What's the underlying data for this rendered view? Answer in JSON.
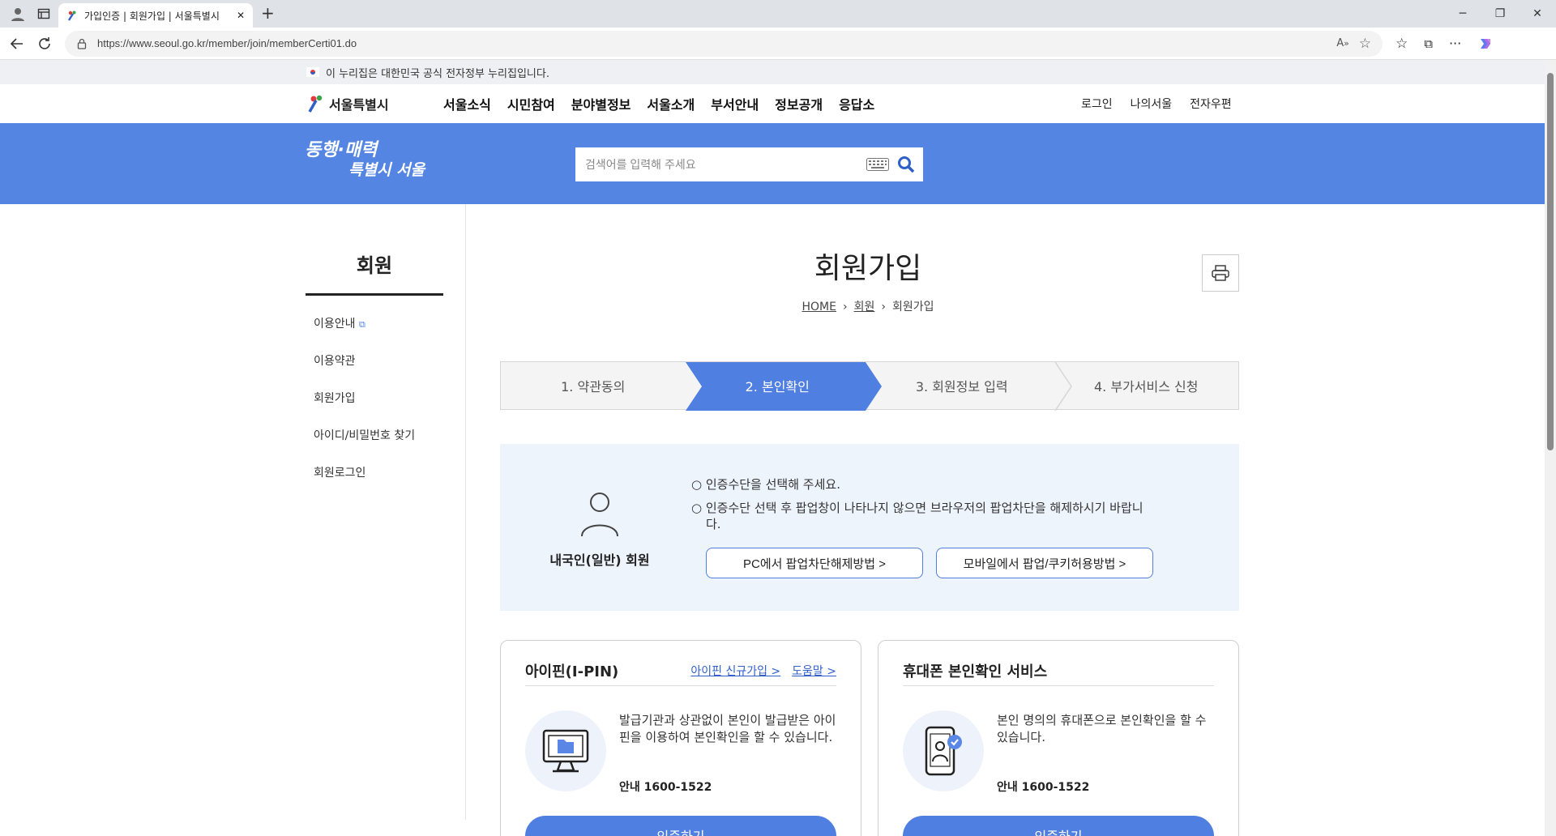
{
  "browser": {
    "tab_title": "가입인증 | 회원가입 | 서울특별시",
    "url": "https://www.seoul.go.kr/member/join/memberCerti01.do"
  },
  "gov_notice": "이 누리집은 대한민국 공식 전자정부 누리집입니다.",
  "brand": {
    "name": "서울특별시"
  },
  "main_menu": [
    "서울소식",
    "시민참여",
    "분야별정보",
    "서울소개",
    "부서안내",
    "정보공개",
    "응답소"
  ],
  "util_menu": [
    "로그인",
    "나의서울",
    "전자우편"
  ],
  "banner": {
    "slogan_line1": "동행·매력",
    "slogan_line2": "특별시 서울",
    "search_placeholder": "검색어를 입력해 주세요"
  },
  "sidebar": {
    "title": "회원",
    "items": [
      "이용안내",
      "이용약관",
      "회원가입",
      "아이디/비밀번호 찾기",
      "회원로그인"
    ]
  },
  "page": {
    "title": "회원가입",
    "breadcrumb": [
      "HOME",
      "회원",
      "회원가입"
    ]
  },
  "steps": [
    "1. 약관동의",
    "2. 본인확인",
    "3. 회원정보 입력",
    "4. 부가서비스 신청"
  ],
  "active_step": 2,
  "auth_panel": {
    "member_type": "내국인(일반) 회원",
    "notes": [
      "인증수단을 선택해 주세요.",
      "인증수단 선택 후 팝업창이 나타나지 않으면 브라우저의 팝업차단을 해제하시기 바랍니다."
    ],
    "buttons": [
      "PC에서 팝업차단해제방법 >",
      "모바일에서 팝업/쿠키허용방법 >"
    ]
  },
  "cards": [
    {
      "title": "아이핀(I-PIN)",
      "links": [
        "아이핀 신규가입 >",
        "도움말 >"
      ],
      "description": "발급기관과 상관없이 본인이 발급받은 아이핀을 이용하여 본인확인을 할 수 있습니다.",
      "tel": "안내 1600-1522",
      "cta": "인증하기"
    },
    {
      "title": "휴대폰 본인확인 서비스",
      "links": [],
      "description": "본인 명의의 휴대폰으로 본인확인을 할 수 있습니다.",
      "tel": "안내 1600-1522",
      "cta": "인증하기"
    }
  ],
  "colors": {
    "primary": "#4f7fe0",
    "banner": "#5485e2",
    "panel": "#eef4fc"
  }
}
